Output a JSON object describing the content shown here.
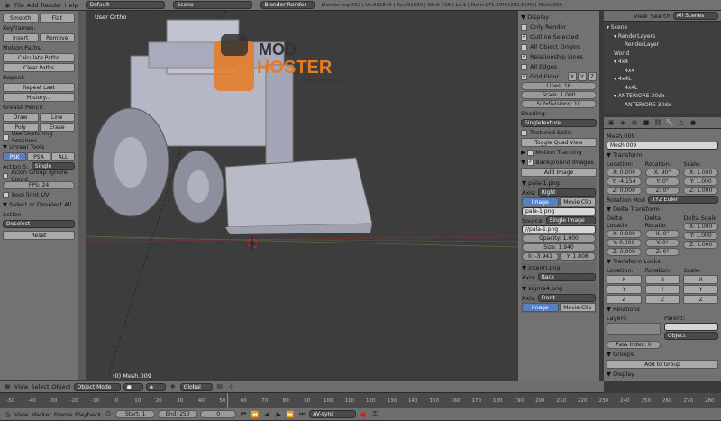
{
  "top": {
    "menus": [
      "File",
      "Add",
      "Render",
      "Help"
    ],
    "layout": "Default",
    "scene": "Scene",
    "engine": "Blender Render",
    "info": "blender.org 262 | Ve:332846 | Fa:291039 | Ob:0-196 | La:1 | Mem:171.30M (262.51M) | Mesh.009"
  },
  "toolshelf": {
    "smooth": "Smooth",
    "flat": "Flat",
    "keyframes": "Keyframes:",
    "insert": "Insert",
    "remove": "Remove",
    "motion_paths": "Motion Paths:",
    "calc_paths": "Calculate Paths",
    "clear_paths": "Clear Paths",
    "repeat": "Repeat:",
    "repeat_last": "Repeat Last",
    "history": "History...",
    "grease": "Grease Pencil:",
    "draw": "Draw",
    "line": "Line",
    "poly": "Poly",
    "erase": "Erase",
    "sketch": "Use Sketching Sessions",
    "unreal": "Unreal Tools",
    "psk": "PSK",
    "psa": "PSA",
    "all": "ALL",
    "action_s": "Action S:",
    "action_s_val": "Single",
    "acion_group": "Acion Group Ignore Count",
    "fps": "FPS: 24",
    "bool_uv": "bool limit UV",
    "select_deselect": "Select or Deselect All",
    "action_lbl": "Action",
    "action_val": "Deselect",
    "reset": "Reset"
  },
  "viewport": {
    "title": "User Ortho",
    "object": "(0) Mesh.009",
    "logo_mod": "MOD",
    "logo_hoster": "HOSTER",
    "logo_url": "www.modhoster.de"
  },
  "vheader": {
    "view": "View",
    "select": "Select",
    "object": "Object",
    "mode": "Object Mode",
    "pivot": "Global"
  },
  "npanel": {
    "display": "Display",
    "only_render": "Only Render",
    "outline": "Outline Selected",
    "all_origins": "All Object Origins",
    "rel_lines": "Relationship Lines",
    "all_edges": "All Edges",
    "grid_floor": "Grid Floor",
    "x": "X",
    "y": "Y",
    "z": "Z",
    "lines": "Lines: 16",
    "scale": "Scale: 1.000",
    "subdiv": "Subdivisions: 10",
    "shading": "Shading:",
    "shading_val": "Singletexture",
    "textured_solid": "Textured Solid",
    "toggle_quad": "Toggle Quad View",
    "motion_tracking": "Motion Tracking",
    "bg_images": "Background Images",
    "add_image": "Add Image",
    "img1": "pala-1.png",
    "axis_lbl": "Axis:",
    "axis1": "Right",
    "image_tab": "Image",
    "movie_tab": "Movie Clip",
    "file1": "pala-1.png",
    "source_lbl": "Source:",
    "source_val": "Single Image",
    "path1": "//pala-1.png",
    "opacity": "Opacity: 1.000",
    "size": "Size: 1.940",
    "offx": "X: -3.941",
    "offy": "Y: 1.808",
    "img2": "intenri.png",
    "axis2": "Back",
    "img3": "sigma4.png",
    "axis3": "Front"
  },
  "outliner": {
    "view": "View",
    "search": "Search",
    "scope": "All Scenes",
    "items": [
      "Scene",
      "RenderLayers",
      "RenderLayer",
      "World",
      "4x4",
      "4x4",
      "4x4L",
      "4x4L",
      "ANTERIORE 30dx",
      "ANTERIORE 30dx"
    ]
  },
  "props": {
    "mesh_path": "Mesh.009",
    "mesh_name": "Mesh.009",
    "transform": "Transform",
    "location": "Location:",
    "rotation": "Rotation:",
    "scale": "Scale:",
    "loc": [
      "X: 0.000",
      "Y: -4.154",
      "Z: 0.000"
    ],
    "rot": [
      "X: 90°",
      "Y: 0°",
      "Z: 0°"
    ],
    "scl": [
      "X: 1.000",
      "Y: 1.000",
      "Z: 1.000"
    ],
    "rot_mode_lbl": "Rotation Mod",
    "rot_mode": "XYZ Euler",
    "delta": "Delta Transform",
    "delta_loc_lbl": "Delta Locatio",
    "delta_rot_lbl": "Delta Rotatio",
    "delta_scale_lbl": "Delta Scale",
    "dloc": [
      "X: 0.000",
      "Y: 0.000",
      "Z: 0.000"
    ],
    "drot": [
      "X: 0°",
      "Y: 0°",
      "Z: 0°"
    ],
    "dscl": [
      "X: 1.000",
      "Y: 1.000",
      "Z: 1.000"
    ],
    "locks": "Transform Locks",
    "lock_loc": "Location:",
    "lock_rot": "Rotation:",
    "lock_scl": "Scale:",
    "lx": "X",
    "ly": "Y",
    "lz": "Z",
    "relations": "Relations",
    "layers": "Layers:",
    "parent": "Parent:",
    "parent_type": "Object",
    "pass_index": "Pass Index: 0",
    "groups": "Groups",
    "add_group": "Add to Group",
    "display2": "Display"
  },
  "timeline": {
    "ruler": [
      "-50",
      "-40",
      "-30",
      "-20",
      "-10",
      "0",
      "10",
      "20",
      "30",
      "40",
      "50",
      "60",
      "70",
      "80",
      "90",
      "100",
      "110",
      "120",
      "130",
      "140",
      "150",
      "160",
      "170",
      "180",
      "190",
      "200",
      "210",
      "220",
      "230",
      "240",
      "250",
      "260",
      "270",
      "280"
    ],
    "view": "View",
    "marker": "Marker",
    "frame": "Frame",
    "playback": "Playback",
    "start": "Start: 1",
    "end": "End: 250",
    "current": "0",
    "sync": "AV-sync"
  }
}
